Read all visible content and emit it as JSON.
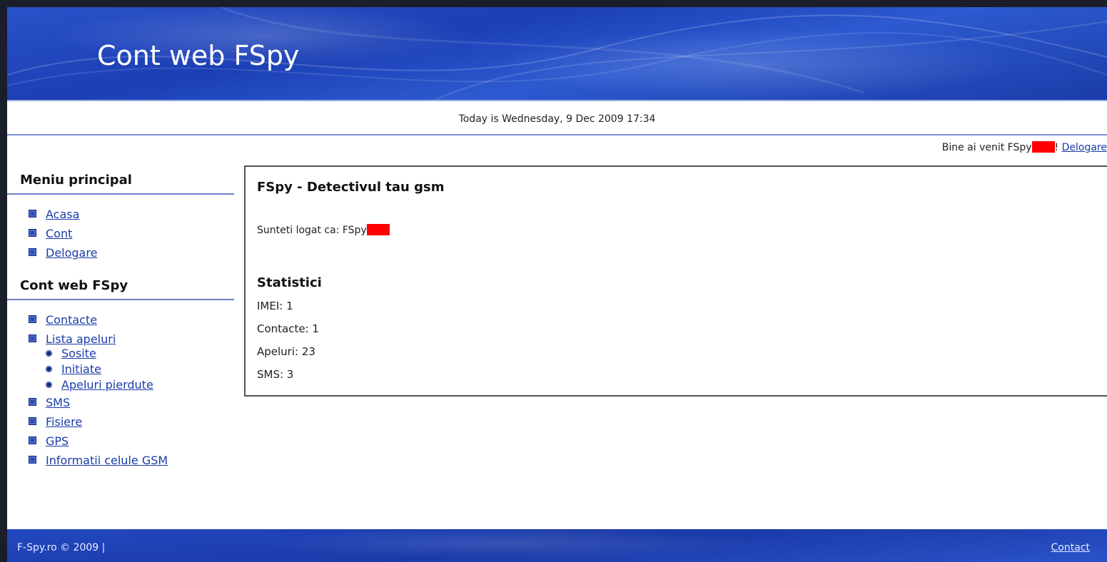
{
  "header": {
    "title": "Cont web FSpy"
  },
  "datebar": {
    "text": "Today is Wednesday, 9 Dec 2009 17:34"
  },
  "welcome": {
    "text": "Bine ai venit FSpy",
    "suffix": "! ",
    "logout_link": "Delogare"
  },
  "sidebar": {
    "main_menu": {
      "heading": "Meniu principal",
      "items": [
        {
          "label": "Acasa"
        },
        {
          "label": "Cont"
        },
        {
          "label": "Delogare"
        }
      ]
    },
    "account_menu": {
      "heading": "Cont web FSpy",
      "items": [
        {
          "label": "Contacte"
        },
        {
          "label": "Lista apeluri"
        },
        {
          "label": "SMS"
        },
        {
          "label": "Fisiere"
        },
        {
          "label": "GPS"
        },
        {
          "label": "Informatii celule GSM"
        }
      ],
      "call_subitems": [
        {
          "label": "Sosite"
        },
        {
          "label": "Initiate"
        },
        {
          "label": "Apeluri pierdute"
        }
      ]
    }
  },
  "content": {
    "title": "FSpy - Detectivul tau gsm",
    "logged_as": "Sunteti logat ca: FSpy",
    "stats_heading": "Statistici",
    "stats": [
      {
        "text": "IMEI: 1"
      },
      {
        "text": "Contacte: 1"
      },
      {
        "text": "Apeluri: 23"
      },
      {
        "text": "SMS: 3"
      }
    ]
  },
  "footer": {
    "copyright": "F-Spy.ro © 2009 |",
    "contact_link": "Contact"
  },
  "colors": {
    "header_blue": "#1b3fb5",
    "redaction": "#ff0000",
    "link": "#1a3ca8"
  }
}
